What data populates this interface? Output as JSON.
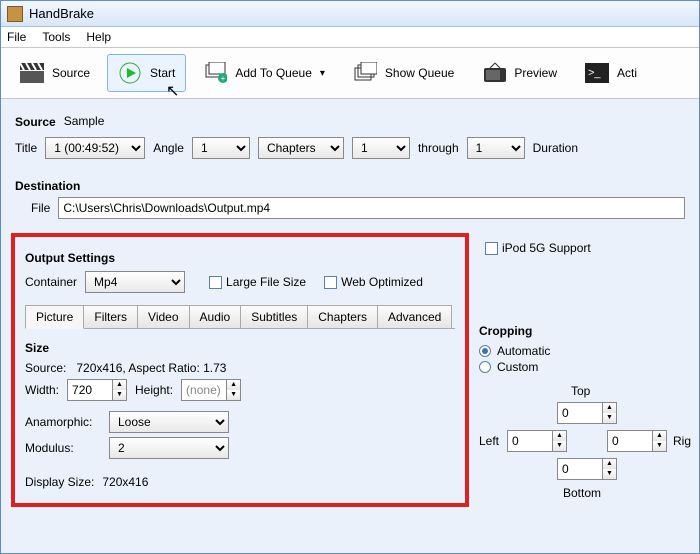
{
  "app": {
    "title": "HandBrake"
  },
  "menu": {
    "file": "File",
    "tools": "Tools",
    "help": "Help"
  },
  "toolbar": {
    "source": "Source",
    "start": "Start",
    "add_queue": "Add To Queue",
    "show_queue": "Show Queue",
    "preview": "Preview",
    "activity": "Acti"
  },
  "source": {
    "label": "Source",
    "value": "Sample",
    "title_label": "Title",
    "title_value": "1 (00:49:52)",
    "angle_label": "Angle",
    "angle_value": "1",
    "range_type": "Chapters",
    "from_value": "1",
    "through_label": "through",
    "to_value": "1",
    "duration_label": "Duration"
  },
  "destination": {
    "label": "Destination",
    "file_label": "File",
    "file_value": "C:\\Users\\Chris\\Downloads\\Output.mp4"
  },
  "output": {
    "heading": "Output Settings",
    "container_label": "Container",
    "container_value": "Mp4",
    "large_file": "Large File Size",
    "web_optimized": "Web Optimized",
    "ipod_5g": "iPod 5G Support"
  },
  "tabs": {
    "picture": "Picture",
    "filters": "Filters",
    "video": "Video",
    "audio": "Audio",
    "subtitles": "Subtitles",
    "chapters": "Chapters",
    "advanced": "Advanced"
  },
  "picture": {
    "size_heading": "Size",
    "source_line": "Source:   720x416, Aspect Ratio: 1.73",
    "width_label": "Width:",
    "width_value": "720",
    "height_label": "Height:",
    "height_value": "(none)",
    "anamorphic_label": "Anamorphic:",
    "anamorphic_value": "Loose",
    "modulus_label": "Modulus:",
    "modulus_value": "2",
    "display_size_label": "Display Size:",
    "display_size_value": "720x416"
  },
  "cropping": {
    "heading": "Cropping",
    "automatic": "Automatic",
    "custom": "Custom",
    "top": "Top",
    "bottom": "Bottom",
    "left": "Left",
    "right": "Rig",
    "v_top": "0",
    "v_left": "0",
    "v_right": "0",
    "v_bottom": "0"
  }
}
